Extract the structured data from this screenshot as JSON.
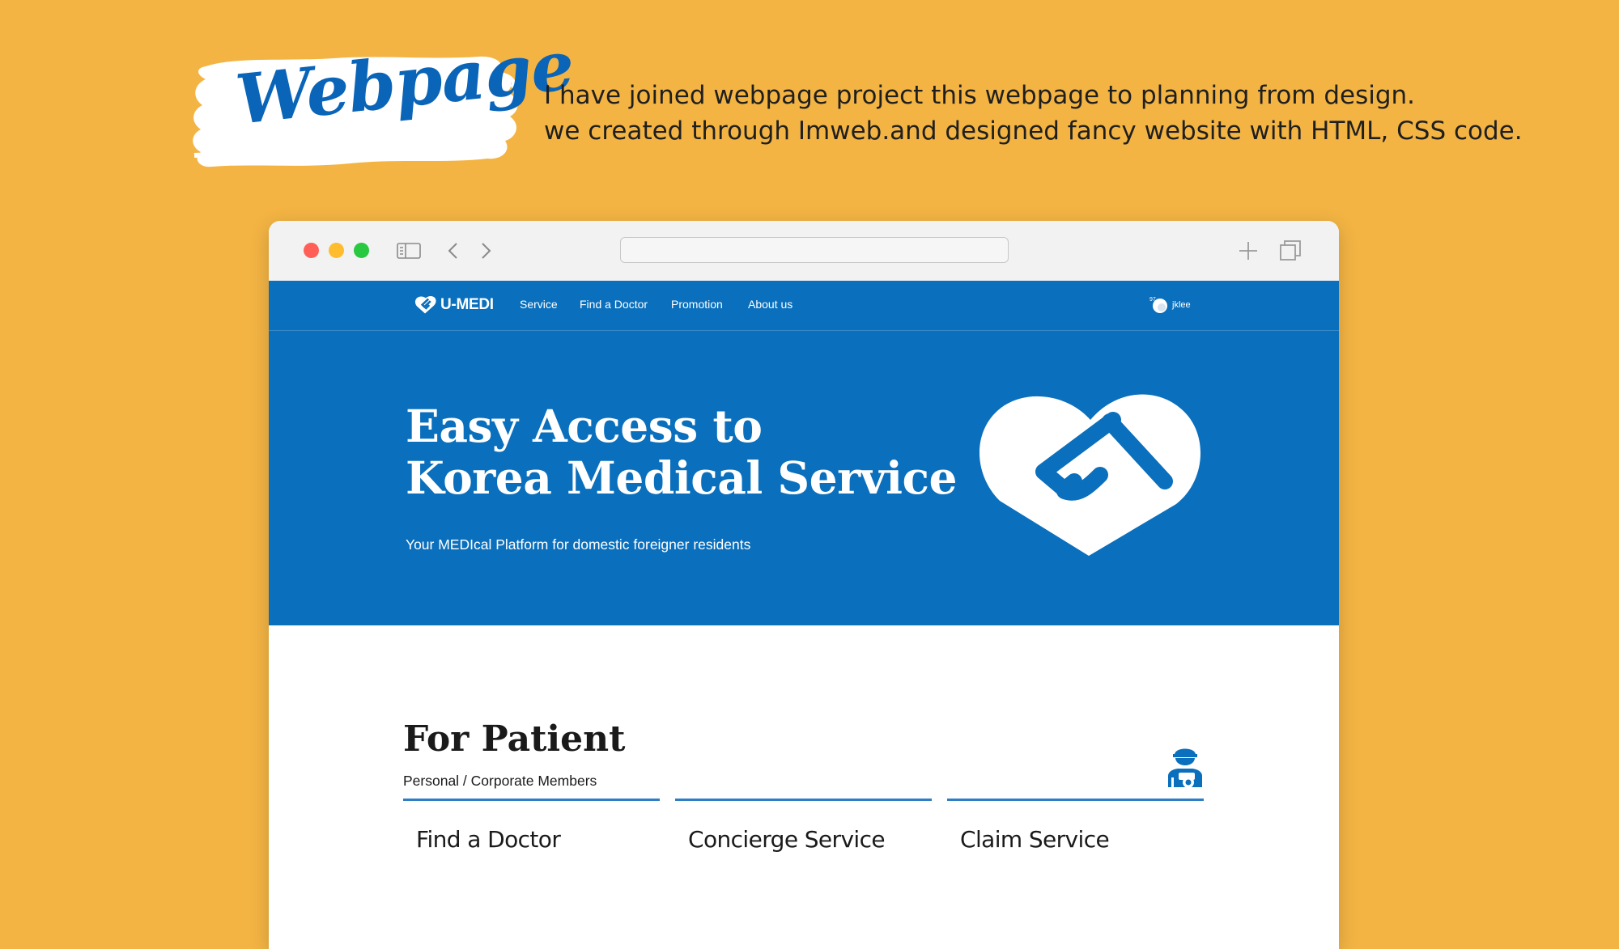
{
  "slide": {
    "badge_title": "Webpage",
    "description_lines": [
      "I have joined webpage project this webpage to planning from design.",
      "we created through Imweb.and designed fancy website with HTML, CSS code."
    ]
  },
  "browser": {
    "address": ""
  },
  "site": {
    "logo_text": "U-MEDI",
    "nav": [
      {
        "label": "Service"
      },
      {
        "label": "Find a Doctor"
      },
      {
        "label": "Promotion"
      },
      {
        "label": "About us"
      }
    ],
    "user": {
      "name": "jklee"
    },
    "hero": {
      "title_lines": [
        "Easy Access to",
        "Korea Medical Service"
      ],
      "subtitle": "Your MEDIcal Platform for domestic foreigner residents"
    },
    "patient": {
      "title": "For Patient",
      "subtitle": "Personal / Corporate  Members",
      "cards": [
        {
          "label": "Find a Doctor"
        },
        {
          "label": "Concierge Service"
        },
        {
          "label": "Claim Service"
        }
      ]
    }
  },
  "colors": {
    "slide_background": "#F3B443",
    "brand_blue": "#0A6FBC",
    "badge_text": "#0A64B8",
    "card_rule": "#2F7DC4"
  },
  "icons": [
    "close-window-icon",
    "minimize-window-icon",
    "zoom-window-icon",
    "sidebar-icon",
    "back-arrow-icon",
    "forward-arrow-icon",
    "new-tab-icon",
    "tabs-overview-icon",
    "u-medi-logo-icon",
    "user-avatar-icon",
    "heart-handshake-logo-icon",
    "patient-icon"
  ]
}
